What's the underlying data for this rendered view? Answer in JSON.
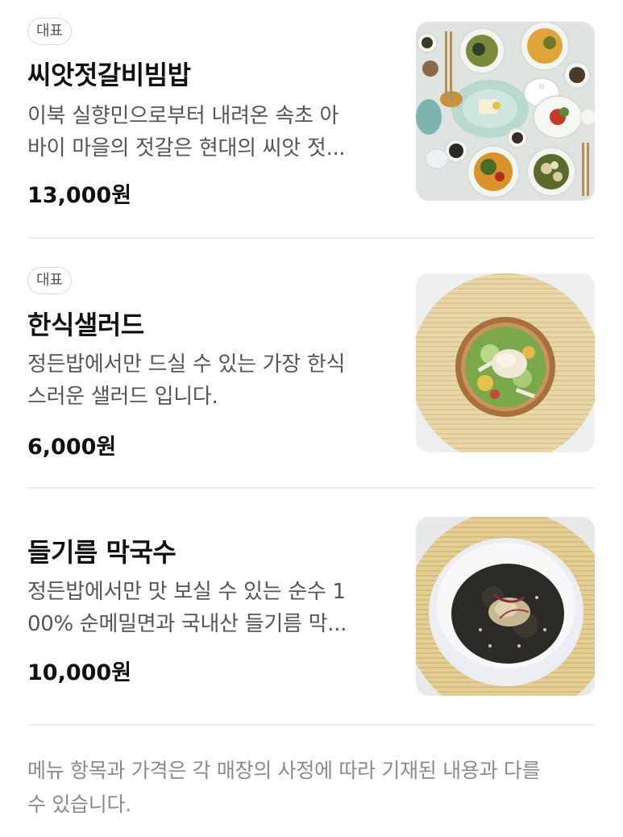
{
  "menu": {
    "items": [
      {
        "badge": "대표",
        "name": "씨앗젓갈비빔밥",
        "desc_lines": [
          "이북 실향민으로부터 내려온 속초 아",
          "바이 마을의 젓갈은 현대의 씨앗 젓..."
        ],
        "price": "13,000원",
        "image": "korean-table-setting-photo"
      },
      {
        "badge": "대표",
        "name": "한식샐러드",
        "desc_lines": [
          "정든밥에서만 드실 수 있는 가장 한식",
          "스러운 샐러드 입니다."
        ],
        "price": "6,000원",
        "image": "salad-bowl-photo"
      },
      {
        "name": "들기름 막국수",
        "desc_lines": [
          "정든밥에서만 맛 보실 수 있는 순수 1",
          "00% 순메밀면과 국내산 들기름 막..."
        ],
        "price": "10,000원",
        "image": "noodle-bowl-photo"
      }
    ]
  },
  "notice": {
    "lines": [
      "메뉴 항목과 가격은 각 매장의 사정에 따라 기재된 내용과 다를",
      "수 있습니다."
    ]
  },
  "colors": {
    "text_primary": "#111111",
    "text_secondary": "#555555",
    "text_muted": "#8a8a8a",
    "divider": "#ececec",
    "badge_border": "#d9d9d9"
  }
}
